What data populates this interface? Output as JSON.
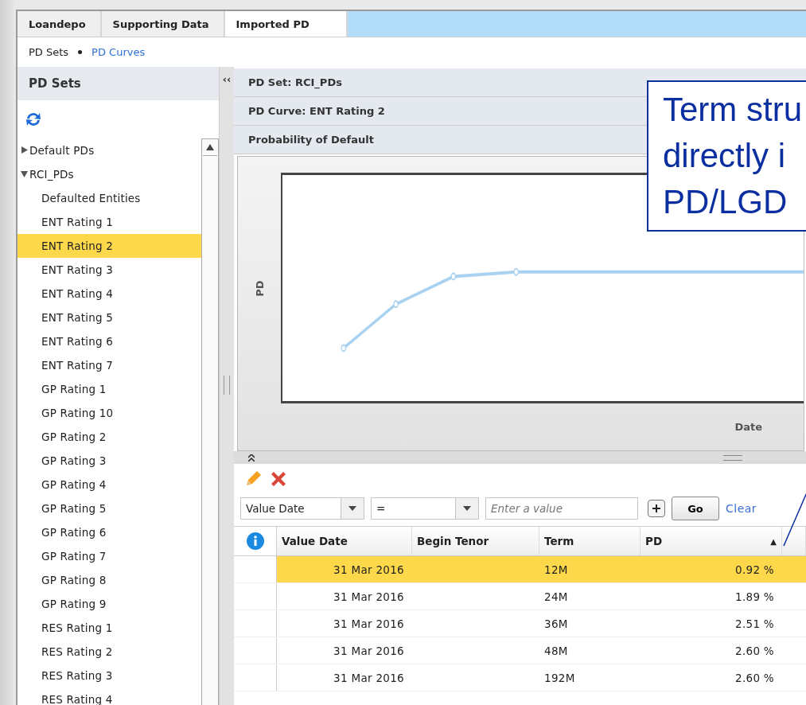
{
  "tabs": [
    {
      "label": "Loandepo",
      "selected": false
    },
    {
      "label": "Supporting Data",
      "selected": false
    },
    {
      "label": "Imported PD",
      "selected": true
    }
  ],
  "breadcrumb": [
    {
      "label": "PD Sets",
      "selected": false
    },
    {
      "label": "PD Curves",
      "selected": true
    }
  ],
  "sidebar": {
    "title": "PD Sets",
    "collapse_glyph": "‹‹",
    "tree": [
      {
        "label": "Default PDs",
        "expanded": false,
        "selected": false
      },
      {
        "label": "RCI_PDs",
        "expanded": true,
        "selected": false,
        "children": [
          {
            "label": "Defaulted Entities",
            "selected": false
          },
          {
            "label": "ENT Rating 1",
            "selected": false
          },
          {
            "label": "ENT Rating 2",
            "selected": true
          },
          {
            "label": "ENT Rating 3",
            "selected": false
          },
          {
            "label": "ENT Rating 4",
            "selected": false
          },
          {
            "label": "ENT Rating 5",
            "selected": false
          },
          {
            "label": "ENT Rating 6",
            "selected": false
          },
          {
            "label": "ENT Rating 7",
            "selected": false
          },
          {
            "label": "GP Rating 1",
            "selected": false
          },
          {
            "label": "GP Rating 10",
            "selected": false
          },
          {
            "label": "GP Rating 2",
            "selected": false
          },
          {
            "label": "GP Rating 3",
            "selected": false
          },
          {
            "label": "GP Rating 4",
            "selected": false
          },
          {
            "label": "GP Rating 5",
            "selected": false
          },
          {
            "label": "GP Rating 6",
            "selected": false
          },
          {
            "label": "GP Rating 7",
            "selected": false
          },
          {
            "label": "GP Rating 8",
            "selected": false
          },
          {
            "label": "GP Rating 9",
            "selected": false
          },
          {
            "label": "RES Rating 1",
            "selected": false
          },
          {
            "label": "RES Rating 2",
            "selected": false
          },
          {
            "label": "RES Rating 3",
            "selected": false
          },
          {
            "label": "RES Rating 4",
            "selected": false
          }
        ]
      }
    ]
  },
  "sections": [
    "PD Set: RCI_PDs",
    "PD Curve: ENT Rating 2",
    "Probability of Default"
  ],
  "chart": {
    "ylabel": "PD",
    "xlabel": "Date"
  },
  "filter": {
    "field": "Value Date",
    "operator": "=",
    "placeholder": "Enter a value",
    "go": "Go",
    "clear": "Clear"
  },
  "table": {
    "columns": [
      {
        "label": "Value Date"
      },
      {
        "label": "Begin Tenor"
      },
      {
        "label": "Term"
      },
      {
        "label": "PD",
        "sort_arrow": "▲"
      }
    ],
    "rows": [
      {
        "value_date": "31 Mar 2016",
        "term": "12M",
        "pd": "0.92 %",
        "selected": true
      },
      {
        "value_date": "31 Mar 2016",
        "term": "24M",
        "pd": "1.89 %",
        "selected": false
      },
      {
        "value_date": "31 Mar 2016",
        "term": "36M",
        "pd": "2.51 %",
        "selected": false
      },
      {
        "value_date": "31 Mar 2016",
        "term": "48M",
        "pd": "2.60 %",
        "selected": false
      },
      {
        "value_date": "31 Mar 2016",
        "term": "192M",
        "pd": "2.60 %",
        "selected": false
      }
    ]
  },
  "callout": {
    "lines": [
      "Term stru",
      "directly i",
      "PD/LGD"
    ]
  }
}
